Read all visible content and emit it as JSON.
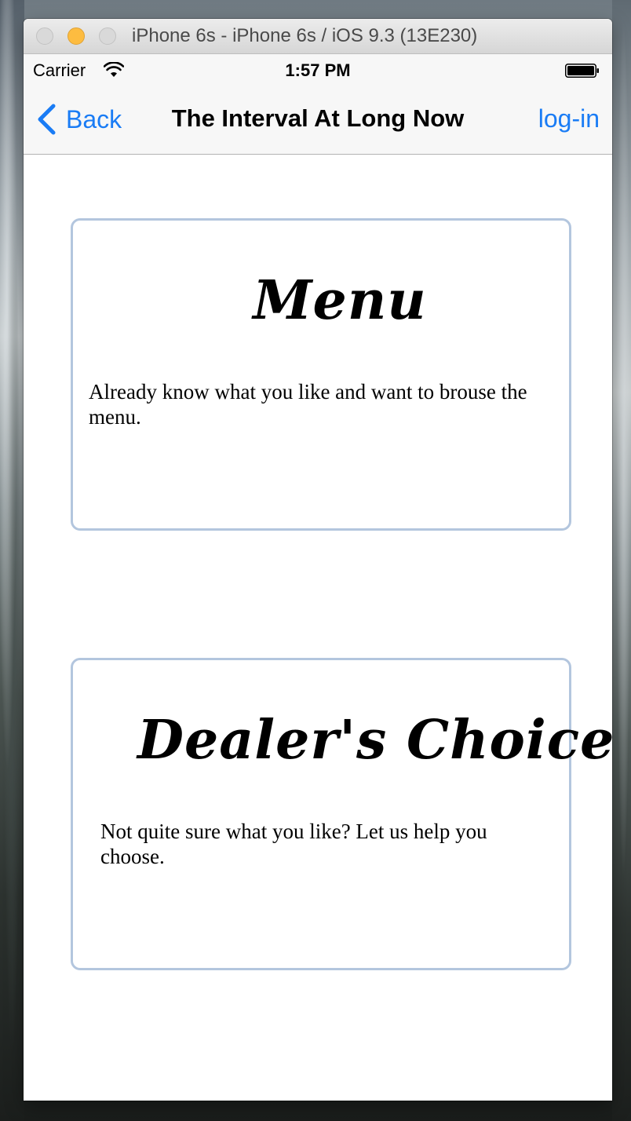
{
  "window": {
    "title": "iPhone 6s - iPhone 6s / iOS 9.3 (13E230)"
  },
  "status_bar": {
    "carrier": "Carrier",
    "time": "1:57 PM",
    "wifi_icon": "wifi-icon",
    "battery_icon": "battery-icon"
  },
  "nav_bar": {
    "back_label": "Back",
    "back_icon": "chevron-left-icon",
    "title": "The Interval At Long Now",
    "login_label": "log-in",
    "tint_color": "#1a7cf5"
  },
  "cards": [
    {
      "heading": "Menu",
      "description": "Already know what you like and want to brouse the menu."
    },
    {
      "heading": "Dealer's Choice",
      "description": "Not quite sure what you like? Let us help you choose."
    }
  ],
  "colors": {
    "card_border": "#b3c6de",
    "traffic_minimize": "#fdbc40"
  }
}
